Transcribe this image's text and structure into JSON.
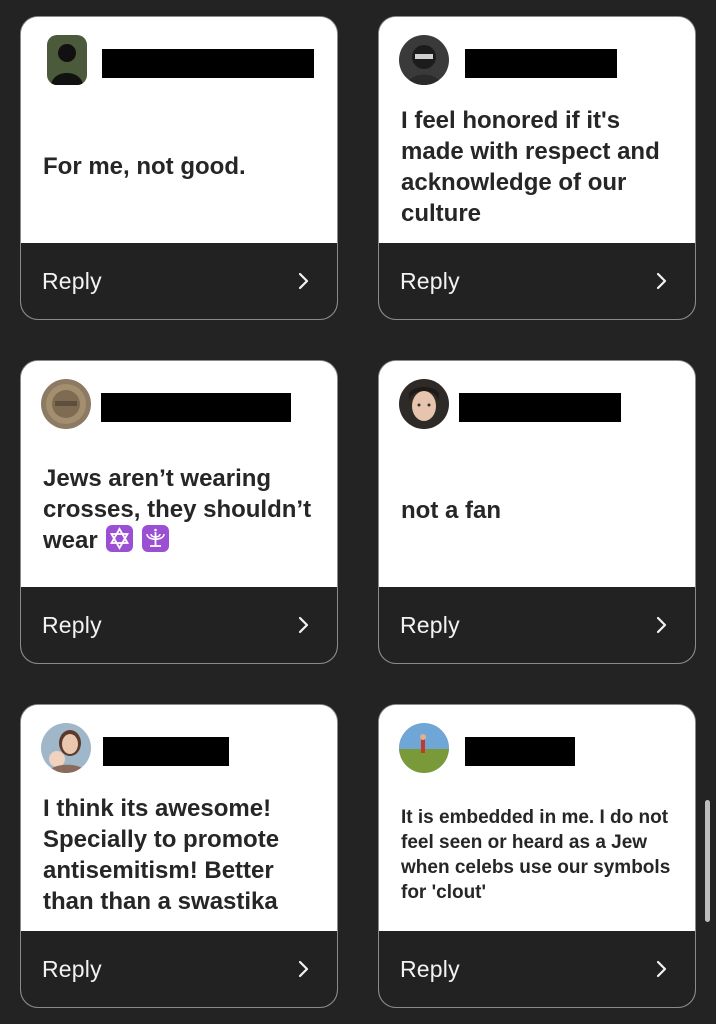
{
  "cards": [
    {
      "message": "For me, not good.",
      "reply_label": "Reply",
      "avatar_icon": "silhouette-avatar-icon"
    },
    {
      "message": "I feel honored if it's made with respect and acknowledge of our culture",
      "reply_label": "Reply",
      "avatar_icon": "masked-person-avatar-icon"
    },
    {
      "message": "Jews aren’t wearing crosses, they shouldn’t wear",
      "emojis": [
        "star-of-david-emoji",
        "menorah-emoji"
      ],
      "reply_label": "Reply",
      "avatar_icon": "coin-avatar-icon"
    },
    {
      "message": "not a fan",
      "reply_label": "Reply",
      "avatar_icon": "woman-portrait-avatar-icon"
    },
    {
      "message": "I think its awesome! Specially to promote antisemitism! Better than than a swastika",
      "reply_label": "Reply",
      "avatar_icon": "mother-child-avatar-icon"
    },
    {
      "message": "It is embedded in me. I do not feel seen or heard as a Jew when celebs use our symbols for 'clout'",
      "reply_label": "Reply",
      "avatar_icon": "field-landscape-avatar-icon"
    }
  ],
  "colors": {
    "background": "#232323",
    "card_body": "#ffffff",
    "reply_bar": "#222222",
    "emoji_tile": "#9b4fd2"
  }
}
